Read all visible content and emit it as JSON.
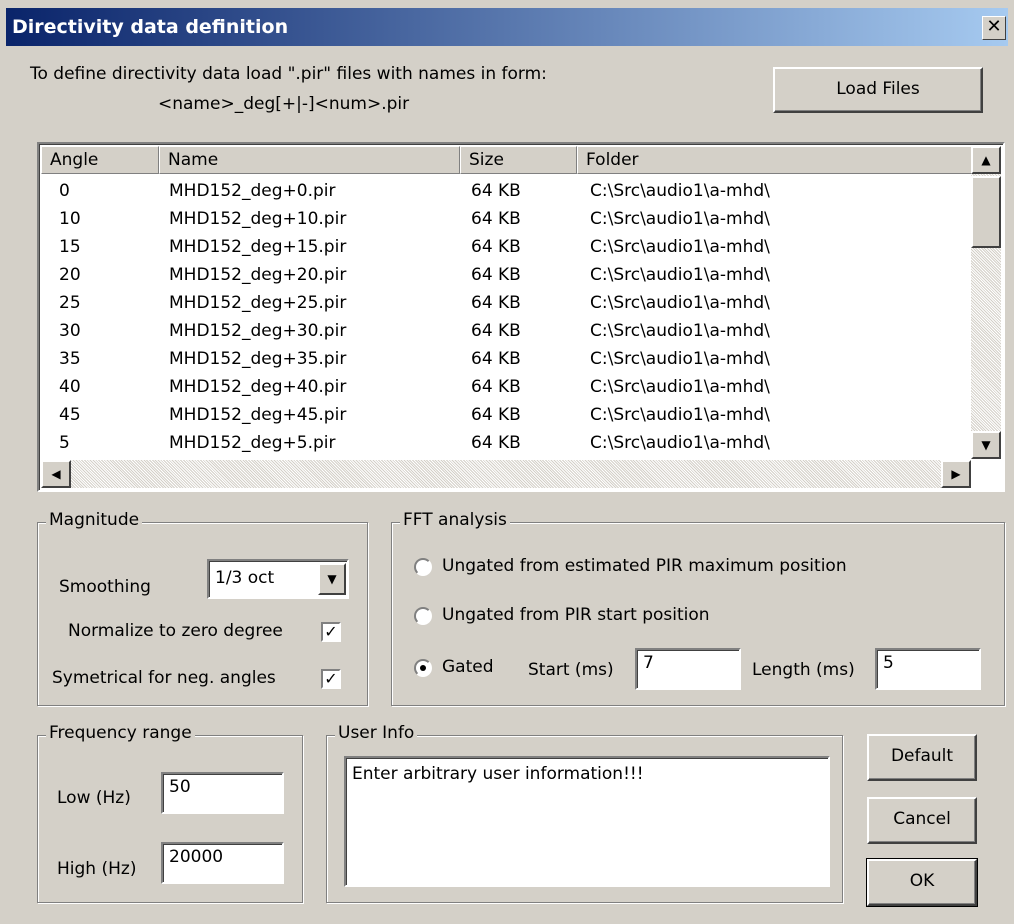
{
  "window": {
    "title": "Directivity data definition",
    "close_glyph": "✕"
  },
  "instructions": {
    "line1": "To define directivity data load \".pir\" files with names in form:",
    "line2": "<name>_deg[+|-]<num>.pir"
  },
  "buttons": {
    "load_files": "Load Files",
    "default": "Default",
    "cancel": "Cancel",
    "ok": "OK"
  },
  "files_table": {
    "columns": [
      "Angle",
      "Name",
      "Size",
      "Folder"
    ],
    "rows": [
      {
        "angle": "0",
        "name": "MHD152_deg+0.pir",
        "size": "64 KB",
        "folder": "C:\\Src\\audio1\\a-mhd\\"
      },
      {
        "angle": "10",
        "name": "MHD152_deg+10.pir",
        "size": "64 KB",
        "folder": "C:\\Src\\audio1\\a-mhd\\"
      },
      {
        "angle": "15",
        "name": "MHD152_deg+15.pir",
        "size": "64 KB",
        "folder": "C:\\Src\\audio1\\a-mhd\\"
      },
      {
        "angle": "20",
        "name": "MHD152_deg+20.pir",
        "size": "64 KB",
        "folder": "C:\\Src\\audio1\\a-mhd\\"
      },
      {
        "angle": "25",
        "name": "MHD152_deg+25.pir",
        "size": "64 KB",
        "folder": "C:\\Src\\audio1\\a-mhd\\"
      },
      {
        "angle": "30",
        "name": "MHD152_deg+30.pir",
        "size": "64 KB",
        "folder": "C:\\Src\\audio1\\a-mhd\\"
      },
      {
        "angle": "35",
        "name": "MHD152_deg+35.pir",
        "size": "64 KB",
        "folder": "C:\\Src\\audio1\\a-mhd\\"
      },
      {
        "angle": "40",
        "name": "MHD152_deg+40.pir",
        "size": "64 KB",
        "folder": "C:\\Src\\audio1\\a-mhd\\"
      },
      {
        "angle": "45",
        "name": "MHD152_deg+45.pir",
        "size": "64 KB",
        "folder": "C:\\Src\\audio1\\a-mhd\\"
      },
      {
        "angle": "5",
        "name": "MHD152_deg+5.pir",
        "size": "64 KB",
        "folder": "C:\\Src\\audio1\\a-mhd\\"
      }
    ]
  },
  "magnitude": {
    "label": "Magnitude",
    "smoothing_label": "Smoothing",
    "smoothing_value": "1/3 oct",
    "normalize_label": "Normalize to zero degree",
    "normalize_checked": true,
    "symmetrical_label": "Symetrical for neg. angles",
    "symmetrical_checked": true
  },
  "fft": {
    "label": "FFT analysis",
    "option1": "Ungated from estimated  PIR maximum  position",
    "option2": "Ungated from PIR start position",
    "option3": "Gated",
    "start_label": "Start (ms)",
    "start_value": "7",
    "length_label": "Length (ms)",
    "length_value": "5",
    "selected": "Gated"
  },
  "frequency": {
    "label": "Frequency range",
    "low_label": "Low (Hz)",
    "low_value": "50",
    "high_label": "High (Hz)",
    "high_value": "20000"
  },
  "user_info": {
    "label": "User Info",
    "value": "Enter arbitrary user information!!!"
  },
  "icons": {
    "close": "close-icon",
    "dropdown": "chevron-down-icon",
    "scroll_up": "arrow-up-icon",
    "scroll_down": "arrow-down-icon",
    "scroll_left": "arrow-left-icon",
    "scroll_right": "arrow-right-icon",
    "check": "check-icon"
  },
  "colors": {
    "titlebar_start": "#0a246a",
    "titlebar_end": "#a6caf0",
    "face": "#d4d0c8"
  }
}
